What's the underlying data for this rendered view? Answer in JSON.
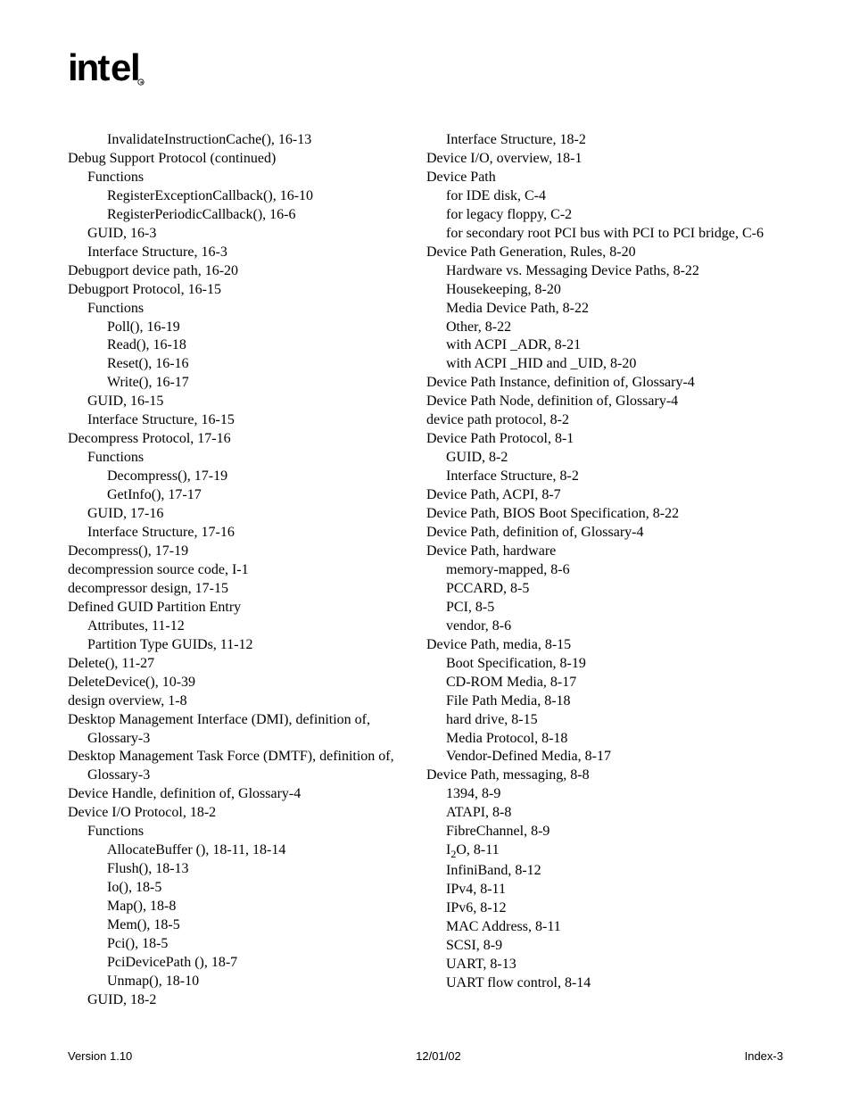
{
  "logo_text": "intel",
  "footer": {
    "version": "Version 1.10",
    "date": "12/01/02",
    "page": "Index-3"
  },
  "left_column": [
    {
      "indent": 2,
      "text": "InvalidateInstructionCache(), 16-13"
    },
    {
      "indent": 0,
      "text": "Debug Support Protocol (continued)"
    },
    {
      "indent": 1,
      "text": "Functions"
    },
    {
      "indent": 2,
      "text": "RegisterExceptionCallback(), 16-10"
    },
    {
      "indent": 2,
      "text": "RegisterPeriodicCallback(), 16-6"
    },
    {
      "indent": 1,
      "text": "GUID, 16-3"
    },
    {
      "indent": 1,
      "text": "Interface Structure, 16-3"
    },
    {
      "indent": 0,
      "text": "Debugport device path, 16-20"
    },
    {
      "indent": 0,
      "text": "Debugport Protocol, 16-15"
    },
    {
      "indent": 1,
      "text": "Functions"
    },
    {
      "indent": 2,
      "text": "Poll(), 16-19"
    },
    {
      "indent": 2,
      "text": "Read(), 16-18"
    },
    {
      "indent": 2,
      "text": "Reset(), 16-16"
    },
    {
      "indent": 2,
      "text": "Write(), 16-17"
    },
    {
      "indent": 1,
      "text": "GUID, 16-15"
    },
    {
      "indent": 1,
      "text": "Interface Structure, 16-15"
    },
    {
      "indent": 0,
      "text": "Decompress Protocol, 17-16"
    },
    {
      "indent": 1,
      "text": "Functions"
    },
    {
      "indent": 2,
      "text": "Decompress(), 17-19"
    },
    {
      "indent": 2,
      "text": "GetInfo(), 17-17"
    },
    {
      "indent": 1,
      "text": "GUID, 17-16"
    },
    {
      "indent": 1,
      "text": "Interface Structure, 17-16"
    },
    {
      "indent": 0,
      "text": "Decompress(), 17-19"
    },
    {
      "indent": 0,
      "text": "decompression source code, I-1"
    },
    {
      "indent": 0,
      "text": "decompressor design, 17-15"
    },
    {
      "indent": 0,
      "text": "Defined GUID Partition Entry"
    },
    {
      "indent": 1,
      "text": "Attributes, 11-12"
    },
    {
      "indent": 1,
      "text": "Partition Type GUIDs, 11-12"
    },
    {
      "indent": 0,
      "text": "Delete(), 11-27"
    },
    {
      "indent": 0,
      "text": "DeleteDevice(), 10-39"
    },
    {
      "indent": 0,
      "text": "design overview, 1-8"
    },
    {
      "indent": 0,
      "text": "Desktop Management Interface (DMI), definition of, Glossary-3"
    },
    {
      "indent": 0,
      "text": "Desktop Management Task Force (DMTF), definition of, Glossary-3"
    },
    {
      "indent": 0,
      "text": "Device Handle, definition of, Glossary-4"
    },
    {
      "indent": 0,
      "text": "Device I/O Protocol, 18-2"
    },
    {
      "indent": 1,
      "text": "Functions"
    },
    {
      "indent": 2,
      "text": "AllocateBuffer (), 18-11, 18-14"
    },
    {
      "indent": 2,
      "text": "Flush(), 18-13"
    },
    {
      "indent": 2,
      "text": "Io(), 18-5"
    },
    {
      "indent": 2,
      "text": "Map(), 18-8"
    },
    {
      "indent": 2,
      "text": "Mem(), 18-5"
    },
    {
      "indent": 2,
      "text": "Pci(), 18-5"
    },
    {
      "indent": 2,
      "text": "PciDevicePath (), 18-7"
    },
    {
      "indent": 2,
      "text": "Unmap(), 18-10"
    },
    {
      "indent": 1,
      "text": "GUID, 18-2"
    }
  ],
  "right_column": [
    {
      "indent": 1,
      "text": "Interface Structure, 18-2"
    },
    {
      "indent": 0,
      "text": "Device I/O, overview, 18-1"
    },
    {
      "indent": 0,
      "text": "Device Path"
    },
    {
      "indent": 1,
      "text": "for IDE disk, C-4"
    },
    {
      "indent": 1,
      "text": "for legacy floppy, C-2"
    },
    {
      "indent": 1,
      "text": "for secondary root PCI bus with PCI to PCI bridge, C-6"
    },
    {
      "indent": 0,
      "text": "Device Path Generation, Rules, 8-20"
    },
    {
      "indent": 1,
      "text": "Hardware vs. Messaging Device Paths, 8-22"
    },
    {
      "indent": 1,
      "text": "Housekeeping, 8-20"
    },
    {
      "indent": 1,
      "text": "Media Device Path, 8-22"
    },
    {
      "indent": 1,
      "text": "Other, 8-22"
    },
    {
      "indent": 1,
      "text": "with ACPI _ADR, 8-21"
    },
    {
      "indent": 1,
      "text": "with ACPI _HID and _UID, 8-20"
    },
    {
      "indent": 0,
      "text": "Device Path Instance, definition of, Glossary-4"
    },
    {
      "indent": 0,
      "text": "Device Path Node, definition of, Glossary-4"
    },
    {
      "indent": 0,
      "text": "device path protocol, 8-2"
    },
    {
      "indent": 0,
      "text": "Device Path Protocol, 8-1"
    },
    {
      "indent": 1,
      "text": "GUID, 8-2"
    },
    {
      "indent": 1,
      "text": "Interface Structure, 8-2"
    },
    {
      "indent": 0,
      "text": "Device Path, ACPI, 8-7"
    },
    {
      "indent": 0,
      "text": "Device Path, BIOS Boot Specification, 8-22"
    },
    {
      "indent": 0,
      "text": "Device Path, definition of, Glossary-4"
    },
    {
      "indent": 0,
      "text": "Device Path, hardware"
    },
    {
      "indent": 1,
      "text": "memory-mapped, 8-6"
    },
    {
      "indent": 1,
      "text": "PCCARD, 8-5"
    },
    {
      "indent": 1,
      "text": "PCI, 8-5"
    },
    {
      "indent": 1,
      "text": "vendor, 8-6"
    },
    {
      "indent": 0,
      "text": "Device Path, media, 8-15"
    },
    {
      "indent": 1,
      "text": "Boot Specification, 8-19"
    },
    {
      "indent": 1,
      "text": "CD-ROM Media, 8-17"
    },
    {
      "indent": 1,
      "text": "File Path Media, 8-18"
    },
    {
      "indent": 1,
      "text": "hard drive, 8-15"
    },
    {
      "indent": 1,
      "text": "Media Protocol, 8-18"
    },
    {
      "indent": 1,
      "text": "Vendor-Defined Media, 8-17"
    },
    {
      "indent": 0,
      "text": "Device Path, messaging, 8-8"
    },
    {
      "indent": 1,
      "text": "1394, 8-9"
    },
    {
      "indent": 1,
      "text": "ATAPI, 8-8"
    },
    {
      "indent": 1,
      "text": "FibreChannel, 8-9"
    },
    {
      "indent": 1,
      "html": "I<sub>2</sub>O, 8-11"
    },
    {
      "indent": 1,
      "text": "InfiniBand, 8-12"
    },
    {
      "indent": 1,
      "text": "IPv4, 8-11"
    },
    {
      "indent": 1,
      "text": "IPv6, 8-12"
    },
    {
      "indent": 1,
      "text": "MAC Address, 8-11"
    },
    {
      "indent": 1,
      "text": "SCSI, 8-9"
    },
    {
      "indent": 1,
      "text": "UART, 8-13"
    },
    {
      "indent": 1,
      "text": "UART flow control, 8-14"
    }
  ]
}
